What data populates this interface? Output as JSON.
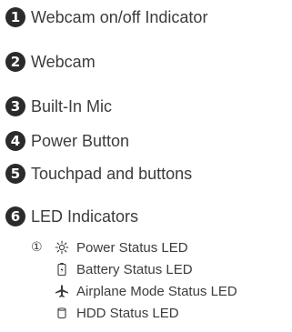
{
  "items": [
    {
      "number": "1",
      "label": "Webcam on/off Indicator"
    },
    {
      "number": "2",
      "label": "Webcam"
    },
    {
      "number": "3",
      "label": "Built-In Mic"
    },
    {
      "number": "4",
      "label": "Power Button"
    },
    {
      "number": "5",
      "label": "Touchpad and buttons"
    },
    {
      "number": "6",
      "label": "LED Indicators"
    }
  ],
  "led_indicators": {
    "marker": "①",
    "entries": [
      {
        "icon": "sun-icon",
        "label": "Power Status LED"
      },
      {
        "icon": "battery-icon",
        "label": "Battery Status LED"
      },
      {
        "icon": "airplane-icon",
        "label": "Airplane Mode Status LED"
      },
      {
        "icon": "hdd-icon",
        "label": "HDD Status LED"
      }
    ]
  },
  "colors": {
    "text": "#3c3c3c",
    "badge": "#2b2b2b"
  }
}
